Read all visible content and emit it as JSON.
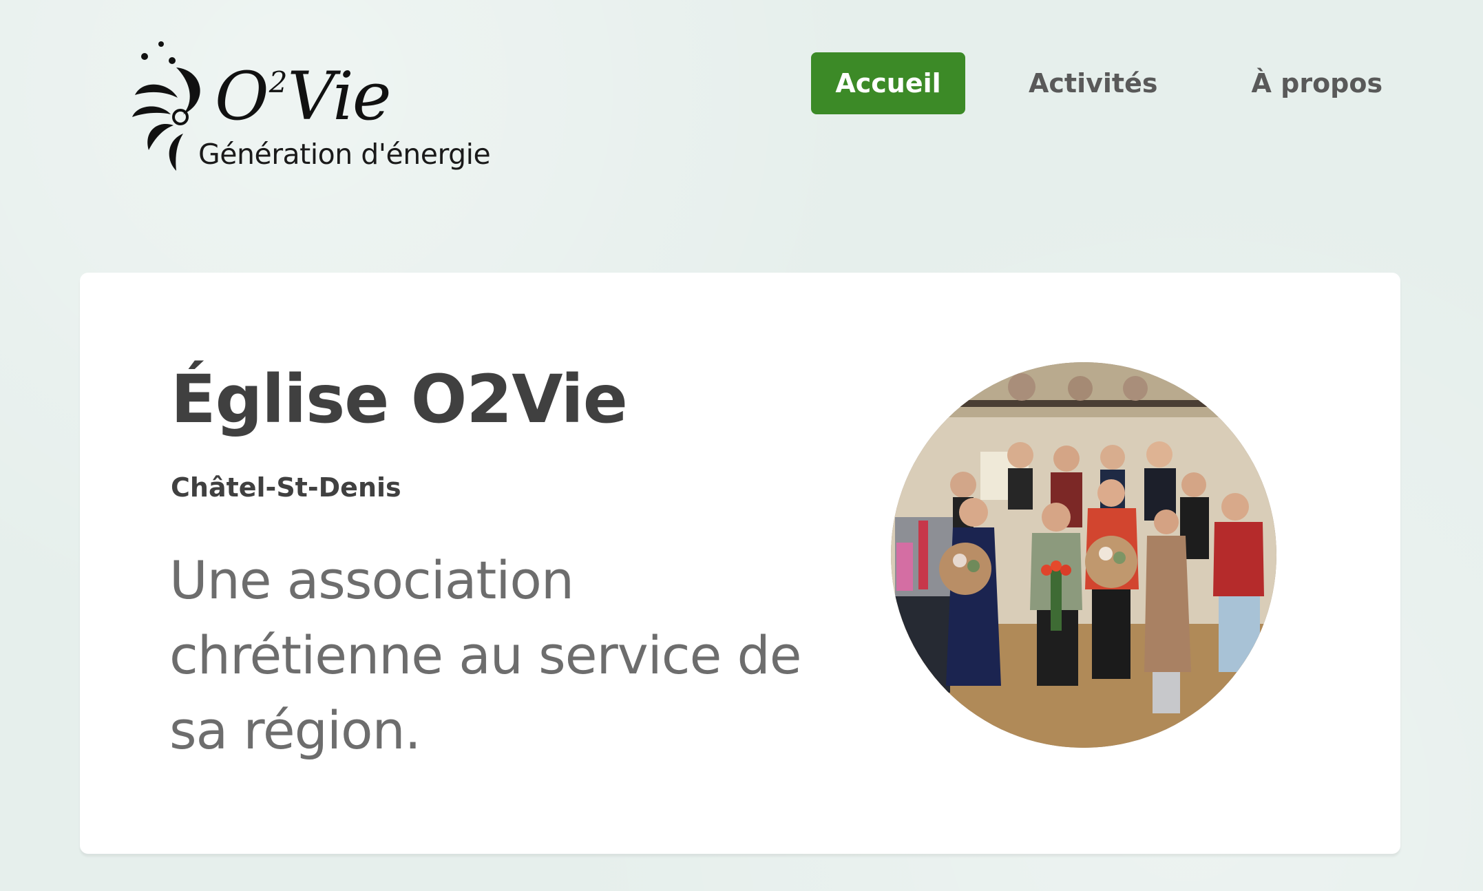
{
  "logo": {
    "wordmark_prefix": "O",
    "wordmark_sup": "2",
    "wordmark_suffix": "Vie",
    "tagline": "Génération d'énergie",
    "icon": "flame-swirl-logo-icon"
  },
  "nav": {
    "items": [
      {
        "label": "Accueil",
        "active": true
      },
      {
        "label": "Activités",
        "active": false
      },
      {
        "label": "À propos",
        "active": false
      }
    ]
  },
  "hero": {
    "title": "Église O2Vie",
    "location": "Châtel-St-Denis",
    "description": "Une association chrétienne au service de sa région.",
    "photo": "group-photo"
  },
  "colors": {
    "page_background": "#e6efec",
    "accent_green": "#3c8a27",
    "card_background": "#ffffff",
    "heading_text": "#404040",
    "body_text": "#6d6d6d",
    "nav_text": "#595959"
  }
}
